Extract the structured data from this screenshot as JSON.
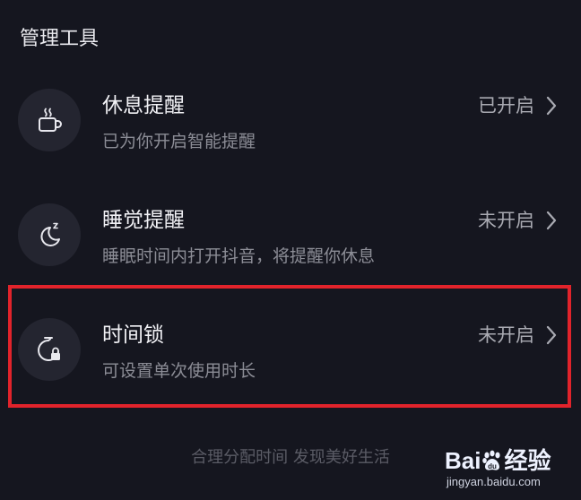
{
  "section": {
    "title": "管理工具"
  },
  "items": [
    {
      "title": "休息提醒",
      "description": "已为你开启智能提醒",
      "status": "已开启",
      "icon": "cup-icon"
    },
    {
      "title": "睡觉提醒",
      "description": "睡眠时间内打开抖音，将提醒你休息",
      "status": "未开启",
      "icon": "moon-icon"
    },
    {
      "title": "时间锁",
      "description": "可设置单次使用时长",
      "status": "未开启",
      "icon": "timer-lock-icon"
    }
  ],
  "footer": {
    "slogan": "合理分配时间 发现美好生活"
  },
  "watermark": {
    "brand_left": "Bai",
    "brand_right": "经验",
    "url": "jingyan.baidu.com"
  },
  "colors": {
    "background": "#15161f",
    "icon_circle": "#242530",
    "highlight": "#e1232b"
  }
}
